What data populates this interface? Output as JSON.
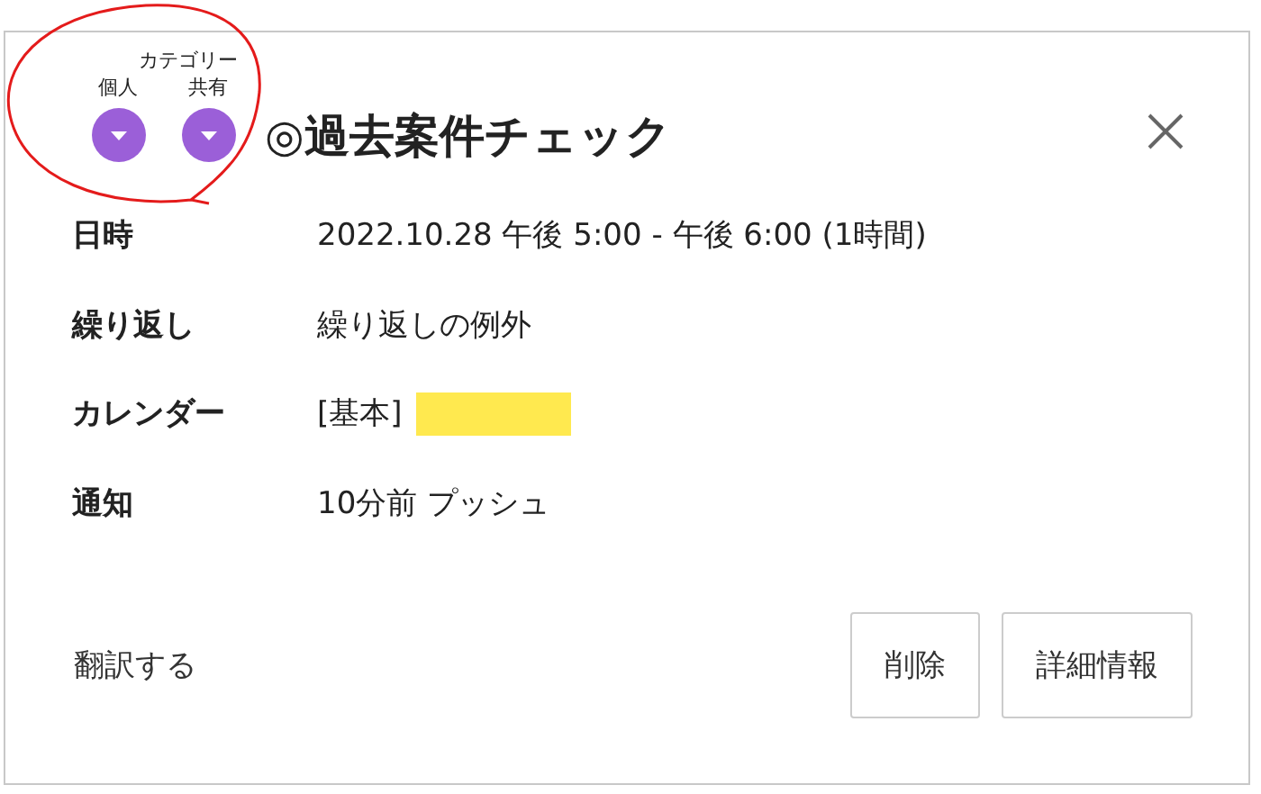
{
  "category": {
    "heading": "カテゴリー",
    "options": [
      {
        "label": "個人"
      },
      {
        "label": "共有"
      }
    ]
  },
  "title": "◎過去案件チェック",
  "details": [
    {
      "label": "日時",
      "value": "2022.10.28 午後 5:00 - 午後 6:00 (1時間)"
    },
    {
      "label": "繰り返し",
      "value": "繰り返しの例外"
    },
    {
      "label": "カレンダー",
      "value": "[基本]",
      "color": "#ffe94f"
    },
    {
      "label": "通知",
      "value": "10分前 プッシュ"
    }
  ],
  "translate_link": "翻訳する",
  "buttons": [
    "削除",
    "詳細情報"
  ]
}
